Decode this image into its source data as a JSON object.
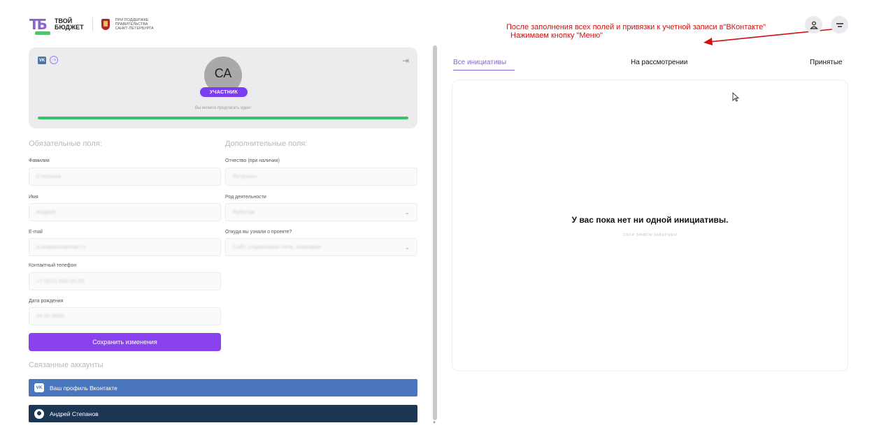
{
  "header": {
    "logo_text_1": "твой",
    "logo_text_2": "бюджет",
    "support_line_1": "при поддержке",
    "support_line_2": "правительства",
    "support_line_3": "санкт-петербурга",
    "icons": [
      "user-icon",
      "menu-icon"
    ]
  },
  "annotation": {
    "line1": "После заполнения  всех полей и привязки к учетной записи в\"ВКонтакте\"",
    "line2": "Нажимаем  кнопку \"Меню\"",
    "color": "#d01010"
  },
  "profile": {
    "initials": "СА",
    "role": "УЧАСТНИК",
    "status_text": "Вы можете предлагать идеи!",
    "progress_percent": 100,
    "progress_color": "#35c26a",
    "badge_color": "#7b3ff0"
  },
  "form": {
    "required_title": "Обязательные поля:",
    "optional_title": "Дополнительные поля:",
    "surname_label": "Фамилия",
    "surname_value": "Степанов",
    "name_label": "Имя",
    "name_value": "Андрей",
    "email_label": "E-mail",
    "email_value": "a.stepanov@mail.ru",
    "phone_label": "Контактный телефон",
    "phone_value": "+7 (911) 000-00-00",
    "birth_label": "Дата рождения",
    "birth_value": "00.00.0000",
    "patronymic_label": "Отчество (при наличии)",
    "patronymic_value": "Петрович",
    "occupation_label": "Род деятельности",
    "occupation_value": "Работаю",
    "source_label": "Откуда вы узнали о проекте?",
    "source_value": "Сайт, социальные сети, знакомые",
    "save_label": "Сохранить изменения",
    "save_color": "#8a42ee"
  },
  "linked": {
    "title": "Связанные аккаунты",
    "vk_label": "Ваш профиль Вконтакте",
    "vk_icon_text": "VK",
    "user_label": "Андрей Степанов"
  },
  "initiatives": {
    "tab_all": "Все инициативы",
    "tab_review": "На рассмотрении",
    "tab_accepted": "Принятые",
    "empty_title": "У вас пока нет ни одной инициативы.",
    "empty_subtitle": "Сбор заявок завершен",
    "accent_color": "#8a63d2"
  }
}
